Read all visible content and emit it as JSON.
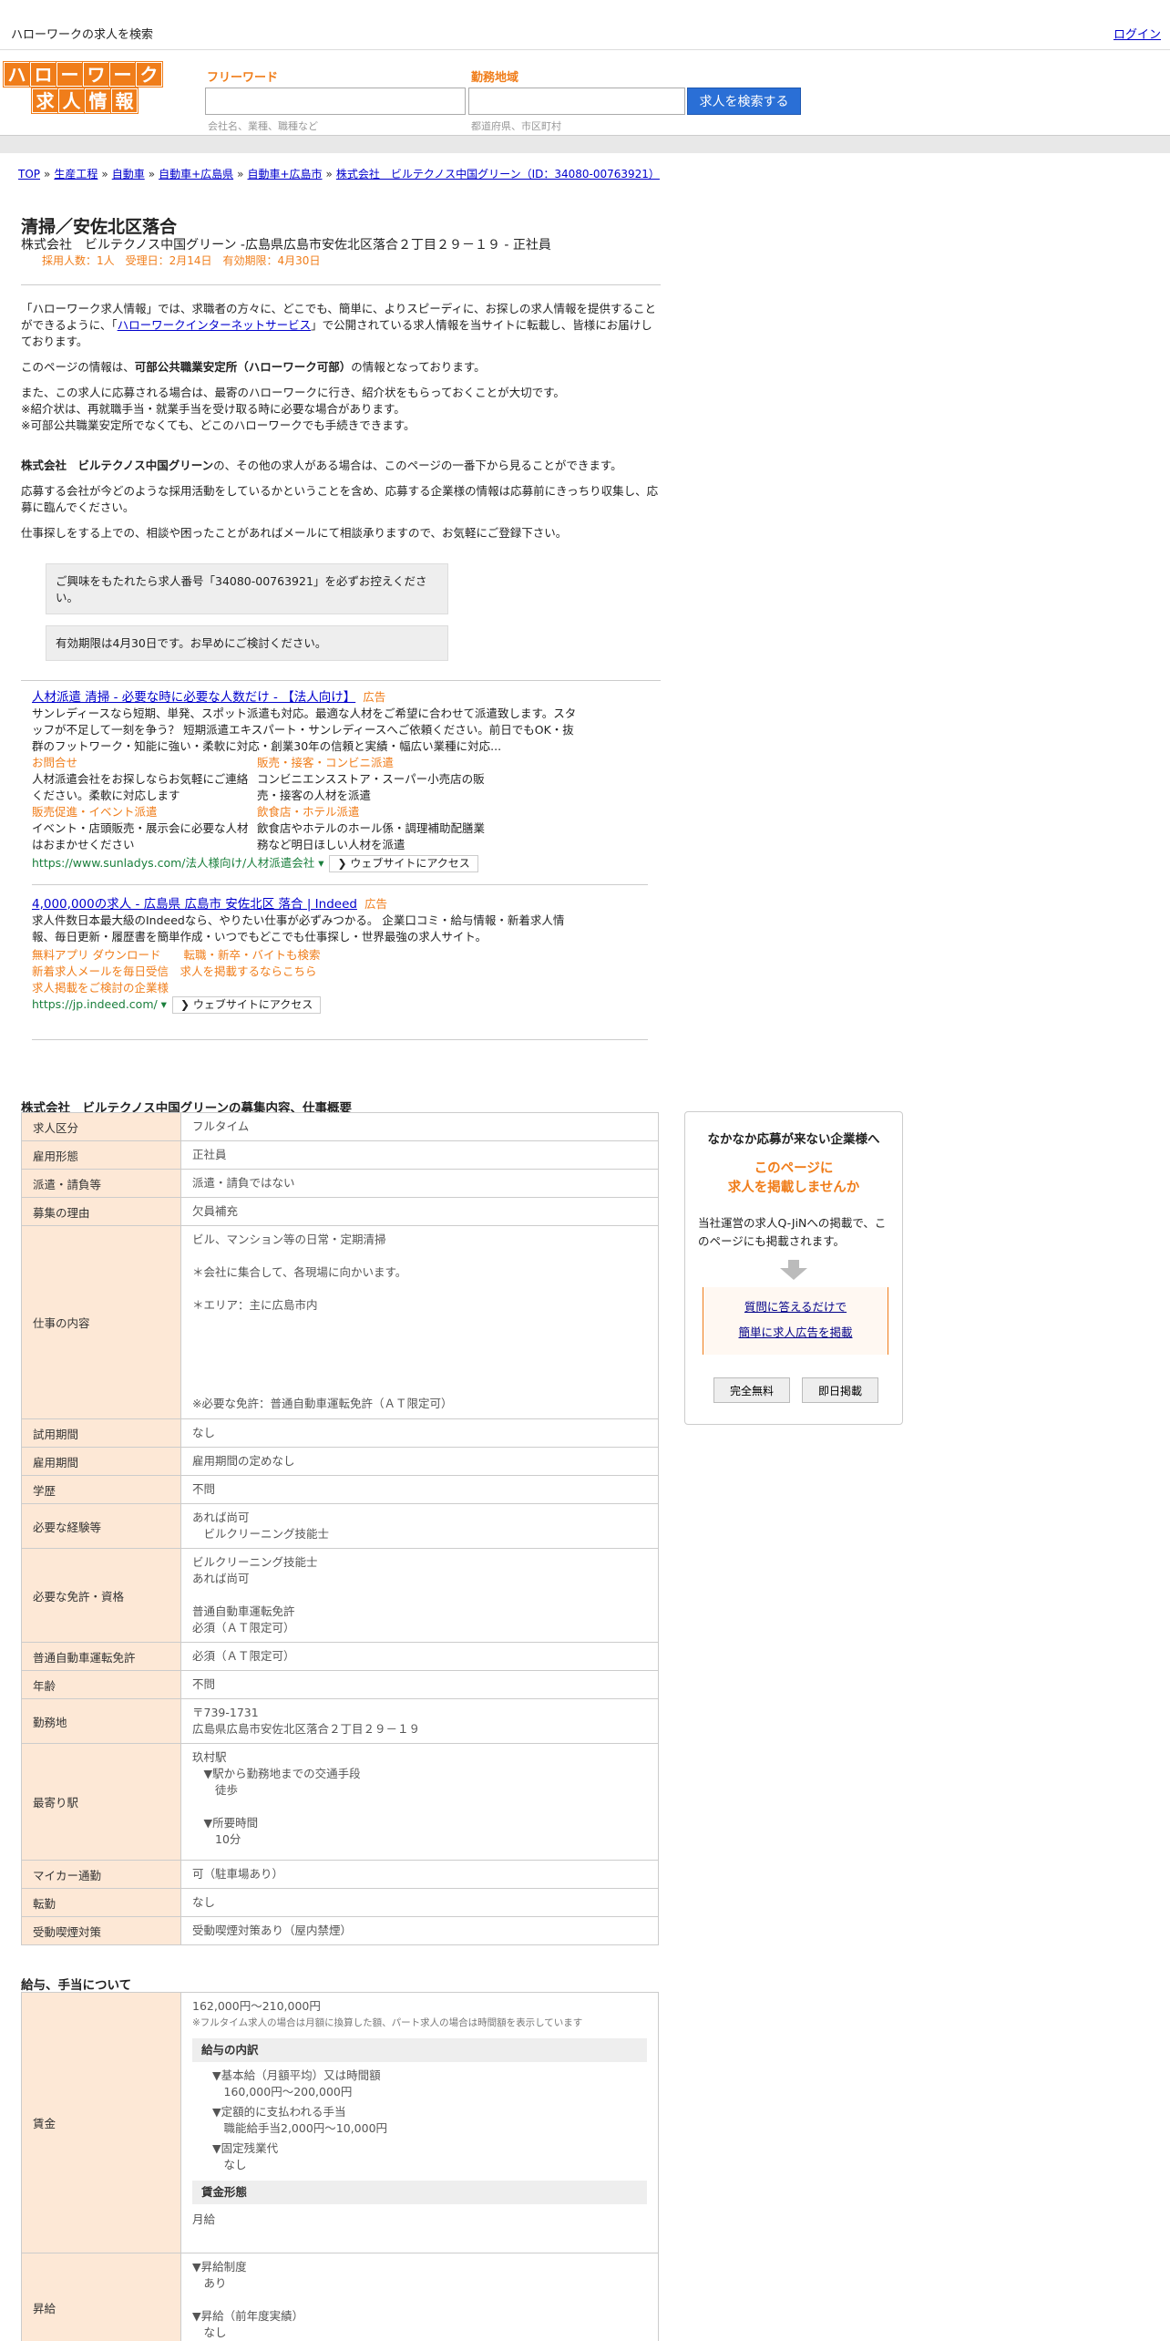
{
  "topbar": {
    "title": "ハローワークの求人を検索",
    "login": "ログイン"
  },
  "logo": {
    "row1": [
      "ハ",
      "ロ",
      "ー",
      "ワ",
      "ー",
      "ク"
    ],
    "row2": [
      "求",
      "人",
      "情",
      "報"
    ]
  },
  "search": {
    "freeword_label": "フリーワード",
    "area_label": "勤務地域",
    "freeword_placeholder": "会社名、業種、職種など",
    "area_placeholder": "都道府県、市区町村",
    "button": "求人を検索する"
  },
  "breadcrumb": [
    "TOP",
    "生産工程",
    "自動車",
    "自動車+広島県",
    "自動車+広島市",
    "株式会社　ビルテクノス中国グリーン（ID：34080-00763921）"
  ],
  "job": {
    "title": "清掃／安佐北区落合",
    "subtitle": "株式会社　ビルテクノス中国グリーン -広島県広島市安佐北区落合２丁目２９－１９ - 正社員",
    "meta": "採用人数：1人　受理日：2月14日　有効期限：4月30日"
  },
  "intro": {
    "p1_a": "「ハローワーク求人情報」では、求職者の方々に、どこでも、簡単に、よりスピーディに、お探しの求人情報を提供することができるように、「",
    "p1_link": "ハローワークインターネットサービス",
    "p1_b": "」で公開されている求人情報を当サイトに転載し、皆様にお届けしております。",
    "p2_a": "このページの情報は、",
    "p2_b": "可部公共職業安定所（ハローワーク可部）",
    "p2_c": "の情報となっております。",
    "p3": "また、この求人に応募される場合は、最寄のハローワークに行き、紹介状をもらっておくことが大切です。\n※紹介状は、再就職手当・就業手当を受け取る時に必要な場合があります。\n※可部公共職業安定所でなくても、どこのハローワークでも手続きできます。",
    "p4_a": "株式会社　ビルテクノス中国グリーン",
    "p4_b": "の、その他の求人がある場合は、このページの一番下から見ることができます。",
    "p5": "応募する会社が今どのような採用活動をしているかということを含め、応募する企業様の情報は応募前にきっちり収集し、応募に臨んでください。",
    "p6": "仕事探しをする上での、相談や困ったことがあればメールにて相談承りますので、お気軽にご登録下さい。"
  },
  "notices": [
    "ご興味をもたれたら求人番号「34080-00763921」を必ずお控えください。",
    "有効期限は4月30日です。お早めにご検討ください。"
  ],
  "ads": [
    {
      "title": "人材派遣 清掃 - 必要な時に必要な人数だけ - 【法人向け】",
      "tag": "広告",
      "desc": "サンレディースなら短期、単発、スポット派遣も対応。最適な人材をご希望に合わせて派遣致します。スタッフが不足して一刻を争う？ 短期派遣エキスパート・サンレディースへご依頼ください。前日でもOK・抜群のフットワーク・知能に強い・柔軟に対応・創業30年の信頼と実績・幅広い業種に対応...",
      "links": [
        {
          "title": "お問合せ",
          "desc": "人材派遣会社をお探しならお気軽にご連絡ください。柔軟に対応します"
        },
        {
          "title": "販売・接客・コンビニ派遣",
          "desc": "コンビニエンスストア・スーパー小売店の販売・接客の人材を派遣"
        },
        {
          "title": "販売促進・イベント派遣",
          "desc": "イベント・店頭販売・展示会に必要な人材はおまかせください"
        },
        {
          "title": "飲食店・ホテル派遣",
          "desc": "飲食店やホテルのホール係・調理補助配膳業務など明日ほしい人材を派遣"
        }
      ],
      "url": "https://www.sunladys.com/法人様向け/人材派遣会社 ▾",
      "visit": "❯ ウェブサイトにアクセス"
    },
    {
      "title": "4,000,000の求人 - 広島県 広島市 安佐北区 落合 | Indeed",
      "tag": "広告",
      "desc": "求人件数日本最大級のIndeedなら、やりたい仕事が必ずみつかる。 企業口コミ・給与情報・新着求人情報、毎日更新・履歴書を簡単作成・いつでもどこでも仕事探し・世界最強の求人サイト。",
      "sub1": "無料アプリ ダウンロード　　転職・新卒・バイトも検索",
      "sub2": "新着求人メールを毎日受信　求人を掲載するならこちら",
      "sub3": "求人掲載をご検討の企業様",
      "url": "https://jp.indeed.com/ ▾",
      "visit": "❯ ウェブサイトにアクセス"
    }
  ],
  "section1": {
    "heading": "株式会社　ビルテクノス中国グリーンの募集内容、仕事概要",
    "rows": [
      {
        "k": "求人区分",
        "v": "フルタイム"
      },
      {
        "k": "雇用形態",
        "v": "正社員"
      },
      {
        "k": "派遣・請負等",
        "v": "派遣・請負ではない"
      },
      {
        "k": "募集の理由",
        "v": "欠員補充"
      },
      {
        "k": "仕事の内容",
        "v": "ビル、マンション等の日常・定期清掃\n\n＊会社に集合して、各現場に向かいます。\n\n＊エリア：主に広島市内\n\n\n\n\n\n※必要な免許：普通自動車運転免許（ＡＴ限定可）"
      },
      {
        "k": "試用期間",
        "v": "なし"
      },
      {
        "k": "雇用期間",
        "v": "雇用期間の定めなし"
      },
      {
        "k": "学歴",
        "v": "不問"
      },
      {
        "k": "必要な経験等",
        "v": "あれば尚可\n　ビルクリーニング技能士"
      },
      {
        "k": "必要な免許・資格",
        "v": "ビルクリーニング技能士\nあれば尚可\n\n普通自動車運転免許\n必須（ＡＴ限定可）"
      },
      {
        "k": "普通自動車運転免許",
        "v": "必須（ＡＴ限定可）"
      },
      {
        "k": "年齢",
        "v": "不問"
      },
      {
        "k": "勤務地",
        "v": "〒739-1731\n広島県広島市安佐北区落合２丁目２９－１９"
      },
      {
        "k": "最寄り駅",
        "v": "玖村駅\n　▼駅から勤務地までの交通手段\n　　徒歩\n\n　▼所要時間\n　　10分"
      },
      {
        "k": "マイカー通勤",
        "v": "可（駐車場あり）"
      },
      {
        "k": "転勤",
        "v": "なし"
      },
      {
        "k": "受動喫煙対策",
        "v": "受動喫煙対策あり（屋内禁煙）"
      }
    ]
  },
  "section2": {
    "heading": "給与、手当について",
    "wage_label": "賃金",
    "wage_range": "162,000円〜210,000円",
    "wage_note": "※フルタイム求人の場合は月額に換算した額、パート求人の場合は時間額を表示しています",
    "breakdown_title": "給与の内訳",
    "b1": "▼基本給（月額平均）又は時間額\n　160,000円〜200,000円",
    "b2": "▼定額的に支払われる手当\n　職能給手当2,000円〜10,000円",
    "b3": "▼固定残業代\n　なし",
    "form_title": "賃金形態",
    "form_value": "月給",
    "raise_label": "昇給",
    "raise_v": "▼昇給制度\n　あり\n\n▼昇給（前年度実績）\n　なし"
  },
  "side": {
    "h1": "なかなか応募が来ない企業様へ",
    "h2": "このページに\n求人を掲載しませんか",
    "p": "当社運営の求人Q-JiNへの掲載で、このページにも掲載されます。",
    "link1": "質問に答えるだけで",
    "link2": "簡単に求人広告を掲載",
    "btn1": "完全無料",
    "btn2": "即日掲載"
  }
}
